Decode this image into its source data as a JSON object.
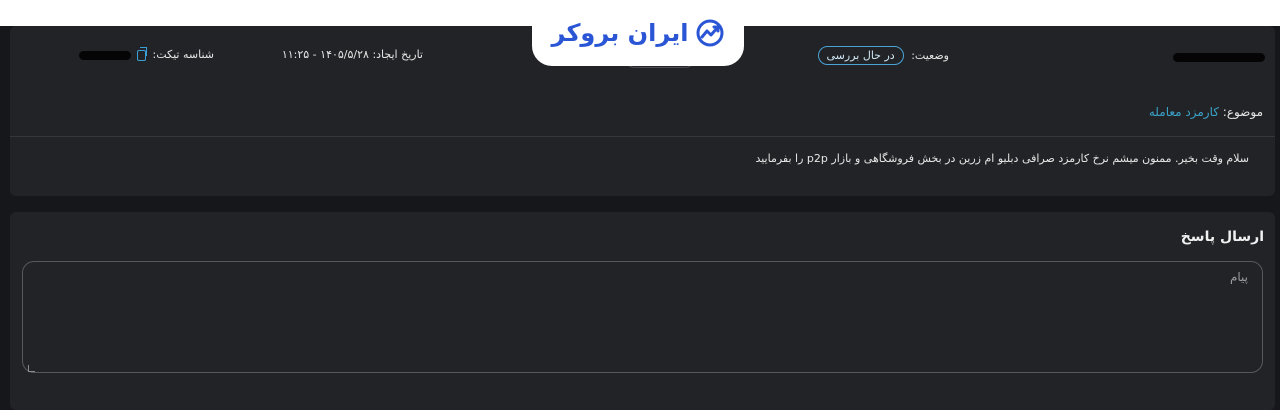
{
  "brand": {
    "name": "ایران بروکر",
    "logo_color": "#2a56d6"
  },
  "ticket": {
    "id_label": "شناسه تیکت:",
    "created_label": "تاریخ ایجاد:",
    "created_value": "۱۴۰۵/۵/۲۸ - ۱۱:۲۵",
    "status_label": "وضعیت:",
    "status_value": "در حال بررسی",
    "subject_label": "موضوع:",
    "subject_value": "کارمزد معامله",
    "message": "سلام وقت بخیر. ممنون میشم نرخ کارمزد صرافی دبلیو ام زرین در بخش فروشگاهی و بازار p2p را بفرمایید"
  },
  "reply": {
    "title": "ارسال پاسخ",
    "placeholder": "پیام"
  },
  "icons": {
    "copy": "copy-icon",
    "logo": "chart-trend-logo-icon"
  },
  "colors": {
    "background": "#16171a",
    "card": "#222326",
    "accent": "#3aa2c9",
    "badge_border": "#4aa3d6"
  }
}
